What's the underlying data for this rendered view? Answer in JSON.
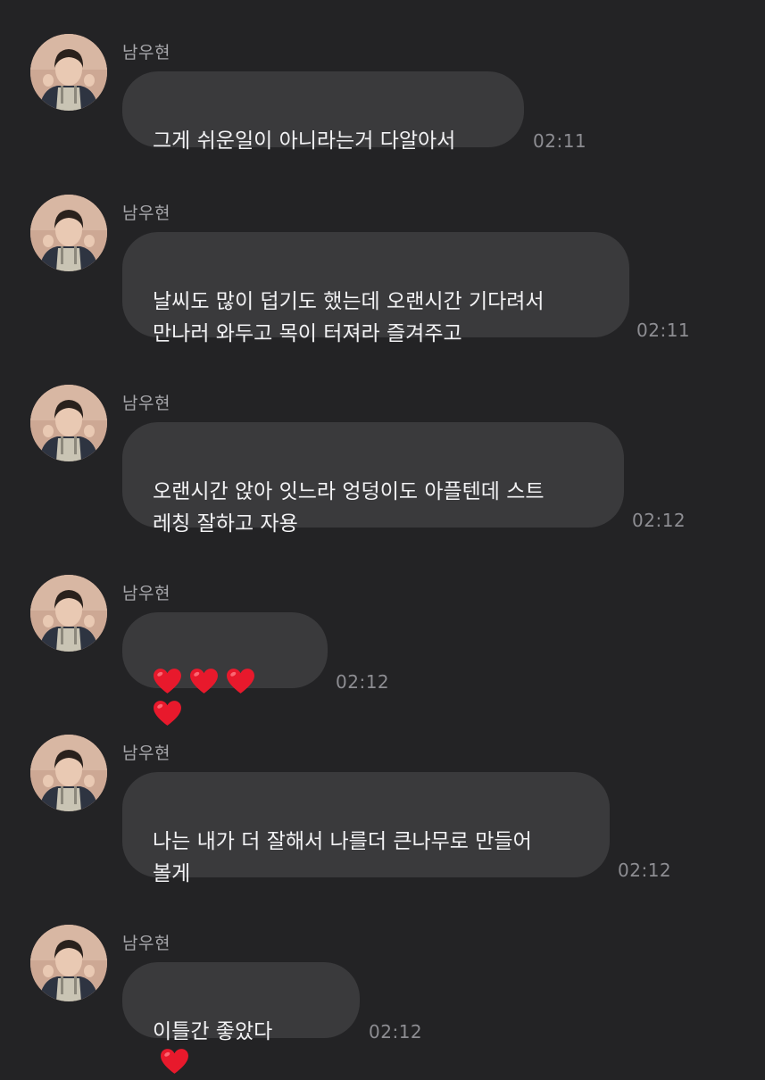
{
  "sender_name": "남우현",
  "messages": [
    {
      "text": "그게 쉬운일이 아니라는거 다알아서",
      "time": "02:11"
    },
    {
      "text": "날씨도 많이 덥기도 했는데 오랜시간 기다려서\n만나러 와두고 목이 터져라 즐겨주고",
      "time": "02:11"
    },
    {
      "text": "오랜시간 앉아 잇느라 엉덩이도 아플텐데 스트\n레칭 잘하고 자용",
      "time": "02:12"
    },
    {
      "text": "",
      "emoji": [
        "red-heart",
        "red-heart",
        "red-heart",
        "red-heart"
      ],
      "time": "02:12"
    },
    {
      "text": "나는 내가 더 잘해서 나를더 큰나무로 만들어\n볼게",
      "time": "02:12"
    },
    {
      "text": "이틀간 좋았다",
      "emoji": [
        "red-heart"
      ],
      "time": "02:12"
    }
  ],
  "colors": {
    "background": "#232325",
    "bubble": "#3a3a3c",
    "text": "#f2f2f4",
    "sender": "#a6a6aa",
    "time": "#8d8d92",
    "heart": "#e8192c"
  }
}
